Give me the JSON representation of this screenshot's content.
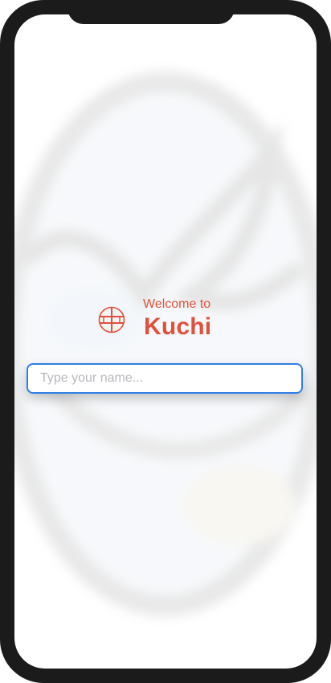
{
  "welcome": {
    "greeting": "Welcome to",
    "app_name": "Kuchi"
  },
  "name_field": {
    "placeholder": "Type your name...",
    "value": ""
  },
  "icons": {
    "logo": "kuchi-logo-icon",
    "background": "background-logo-art"
  },
  "colors": {
    "accent": "#e0503c",
    "input_border": "#2f7ee6",
    "frame": "#1b1b1b"
  }
}
